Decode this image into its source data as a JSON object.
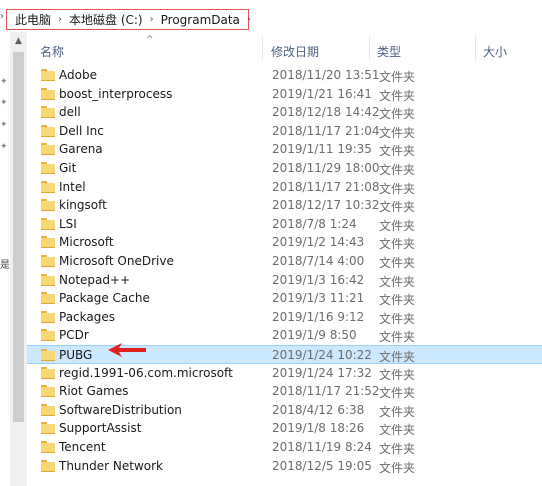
{
  "address": {
    "crumbs": [
      "此电脑",
      "本地磁盘 (C:)",
      "ProgramData"
    ],
    "separator": "›"
  },
  "columns": {
    "name": "名称",
    "date": "修改日期",
    "type": "类型",
    "size": "大小"
  },
  "files": [
    {
      "name": "Adobe",
      "date": "2018/11/20 13:51",
      "type": "文件夹"
    },
    {
      "name": "boost_interprocess",
      "date": "2019/1/21 16:41",
      "type": "文件夹"
    },
    {
      "name": "dell",
      "date": "2018/12/18 14:42",
      "type": "文件夹"
    },
    {
      "name": "Dell Inc",
      "date": "2018/11/17 21:04",
      "type": "文件夹"
    },
    {
      "name": "Garena",
      "date": "2019/1/11 19:35",
      "type": "文件夹"
    },
    {
      "name": "Git",
      "date": "2018/11/29 18:00",
      "type": "文件夹"
    },
    {
      "name": "Intel",
      "date": "2018/11/17 21:08",
      "type": "文件夹"
    },
    {
      "name": "kingsoft",
      "date": "2018/12/17 10:32",
      "type": "文件夹"
    },
    {
      "name": "LSI",
      "date": "2018/7/8 1:24",
      "type": "文件夹"
    },
    {
      "name": "Microsoft",
      "date": "2019/1/2 14:43",
      "type": "文件夹"
    },
    {
      "name": "Microsoft OneDrive",
      "date": "2018/7/14 4:00",
      "type": "文件夹"
    },
    {
      "name": "Notepad++",
      "date": "2019/1/3 16:42",
      "type": "文件夹"
    },
    {
      "name": "Package Cache",
      "date": "2019/1/3 11:21",
      "type": "文件夹"
    },
    {
      "name": "Packages",
      "date": "2019/1/16 9:12",
      "type": "文件夹"
    },
    {
      "name": "PCDr",
      "date": "2019/1/9 8:50",
      "type": "文件夹"
    },
    {
      "name": "PUBG",
      "date": "2019/1/24 10:22",
      "type": "文件夹",
      "selected": true
    },
    {
      "name": "regid.1991-06.com.microsoft",
      "date": "2019/1/24 17:32",
      "type": "文件夹"
    },
    {
      "name": "Riot Games",
      "date": "2018/11/17 21:52",
      "type": "文件夹"
    },
    {
      "name": "SoftwareDistribution",
      "date": "2018/4/12 6:38",
      "type": "文件夹"
    },
    {
      "name": "SupportAssist",
      "date": "2019/1/8 18:26",
      "type": "文件夹"
    },
    {
      "name": "Tencent",
      "date": "2018/11/19 8:24",
      "type": "文件夹"
    },
    {
      "name": "Thunder Network",
      "date": "2018/12/5 19:05",
      "type": "文件夹"
    }
  ],
  "colors": {
    "highlight_box": "#e35555",
    "selected_row": "#cce8ff",
    "annotation_arrow": "#e02020",
    "folder": "#f8d775"
  },
  "icons": {
    "folder": "folder-icon",
    "scroll_up": "chevron-up-icon",
    "breadcrumb_sep": "chevron-right-icon",
    "annotation": "red-arrow-icon"
  },
  "navstrip": {
    "cut_label": "是"
  }
}
